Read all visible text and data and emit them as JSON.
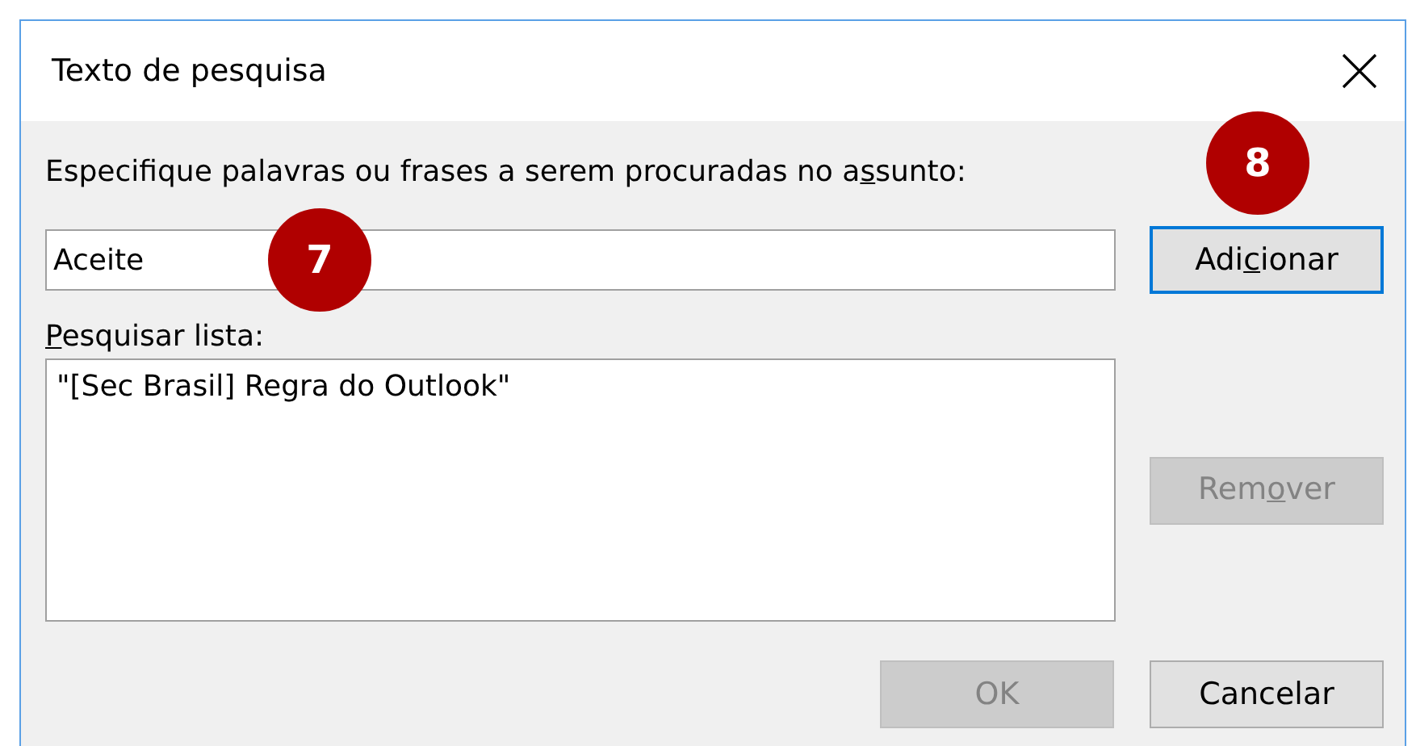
{
  "window": {
    "title": "Texto de pesquisa"
  },
  "subject_label": {
    "before": "Especifique palavras ou frases a serem procuradas no a",
    "key": "s",
    "after": "sunto:"
  },
  "search_field": {
    "value": "Aceite"
  },
  "add_button": {
    "label": {
      "before": "Adi",
      "key": "c",
      "after": "ionar"
    },
    "default": true,
    "disabled": false
  },
  "list_label": {
    "key": "P",
    "after": "esquisar lista:"
  },
  "search_list": {
    "items": [
      {
        "text": "\"[Sec Brasil] Regra do Outlook\"",
        "selected": false
      }
    ]
  },
  "remove_button": {
    "label": {
      "before": "Rem",
      "key": "o",
      "after": "ver"
    },
    "disabled": true
  },
  "ok_button": {
    "label": {
      "before": "OK"
    },
    "disabled": true
  },
  "cancel_button": {
    "label": {
      "before": "Cancelar"
    },
    "default": false,
    "disabled": false
  },
  "callouts": [
    {
      "text": "7"
    },
    {
      "text": "8"
    }
  ]
}
